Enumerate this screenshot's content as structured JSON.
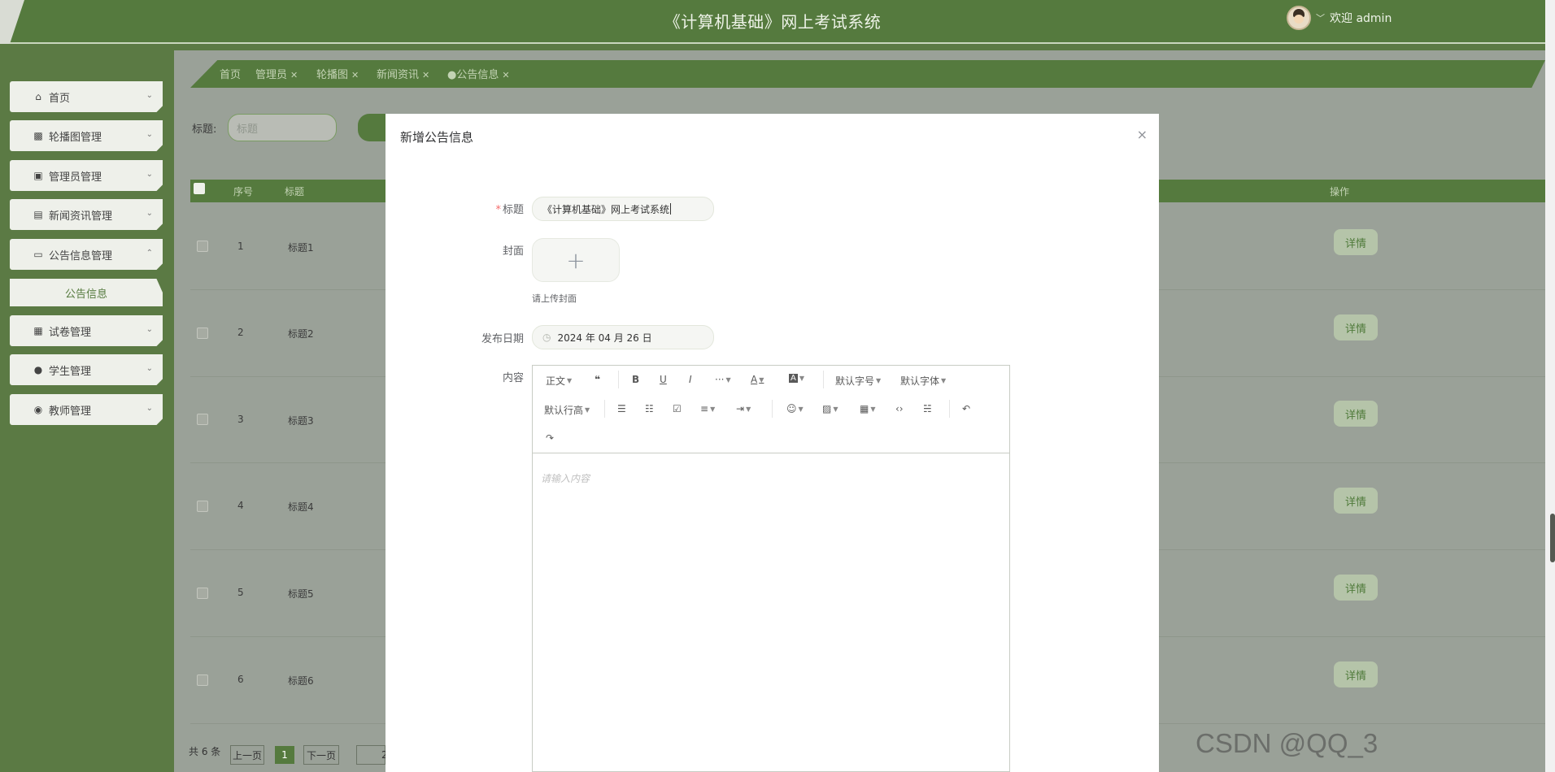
{
  "app": {
    "title": "《计算机基础》网上考试系统",
    "welcome": "欢迎 admin"
  },
  "sidebar": {
    "items": [
      {
        "label": "首页",
        "icon": "home-icon"
      },
      {
        "label": "轮播图管理",
        "icon": "image-icon"
      },
      {
        "label": "管理员管理",
        "icon": "user-card-icon"
      },
      {
        "label": "新闻资讯管理",
        "icon": "news-icon"
      },
      {
        "label": "公告信息管理",
        "icon": "printer-icon"
      },
      {
        "label": "试卷管理",
        "icon": "grid-icon"
      },
      {
        "label": "学生管理",
        "icon": "person-icon"
      },
      {
        "label": "教师管理",
        "icon": "teacher-icon"
      }
    ],
    "subitem": "公告信息"
  },
  "tabs": [
    {
      "label": "首页"
    },
    {
      "label": "管理员"
    },
    {
      "label": "轮播图"
    },
    {
      "label": "新闻资讯"
    },
    {
      "label": "●公告信息"
    }
  ],
  "search": {
    "label": "标题:",
    "placeholder": "标题"
  },
  "table": {
    "headers": [
      "序号",
      "标题",
      "操作"
    ],
    "rows": [
      {
        "index": "1",
        "title": "标题1",
        "action": "详情"
      },
      {
        "index": "2",
        "title": "标题2",
        "action": "详情"
      },
      {
        "index": "3",
        "title": "标题3",
        "action": "详情"
      },
      {
        "index": "4",
        "title": "标题4",
        "action": "详情"
      },
      {
        "index": "5",
        "title": "标题5",
        "action": "详情"
      },
      {
        "index": "6",
        "title": "标题6",
        "action": "详情"
      }
    ]
  },
  "pager": {
    "total": "共 6 条",
    "prev": "上一页",
    "current": "1",
    "next": "下一页",
    "size": "2"
  },
  "modal": {
    "title": "新增公告信息",
    "close": "×",
    "fields": {
      "title_label": "标题",
      "title_value": "《计算机基础》网上考试系统",
      "cover_label": "封面",
      "cover_tip": "请上传封面",
      "date_label": "发布日期",
      "date_value": "2024 年 04 月 26 日",
      "content_label": "内容"
    },
    "editor": {
      "toolbar_row1": [
        "正文",
        "❝",
        "B",
        "U",
        "I",
        "···",
        "A",
        "A",
        "默认字号",
        "默认字体"
      ],
      "toolbar_row2": [
        "默认行高",
        "☰",
        "☷",
        "☑",
        "≡",
        "⇥",
        "☺",
        "▨",
        "▦",
        "‹›",
        "☵",
        "↶"
      ],
      "toolbar_row3": [
        "↷"
      ],
      "placeholder": "请输入内容"
    }
  },
  "watermark": "CSDN @QQ_3",
  "colors": {
    "primary": "#557a3e",
    "overlay": "#9aa198",
    "required": "#f56c6c"
  }
}
